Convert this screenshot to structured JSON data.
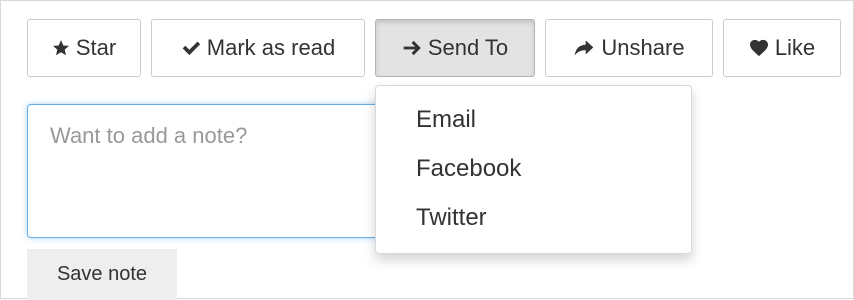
{
  "toolbar": {
    "buttons": [
      {
        "label": "Star",
        "icon": "star-icon"
      },
      {
        "label": "Mark as read",
        "icon": "check-icon"
      },
      {
        "label": "Send To",
        "icon": "arrow-right-icon"
      },
      {
        "label": "Unshare",
        "icon": "share-icon"
      },
      {
        "label": "Like",
        "icon": "heart-icon"
      }
    ]
  },
  "note": {
    "placeholder": "Want to add a note?",
    "value": ""
  },
  "save_button": {
    "label": "Save note"
  },
  "send_menu": {
    "items": [
      "Email",
      "Facebook",
      "Twitter"
    ]
  }
}
